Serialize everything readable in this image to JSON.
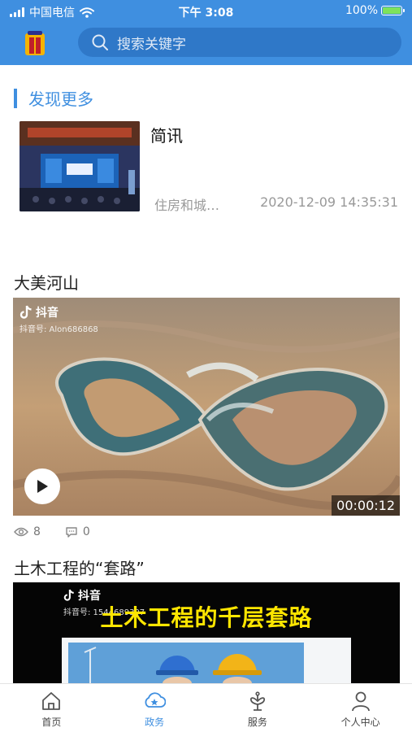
{
  "status_bar": {
    "carrier": "中国电信",
    "time": "下午 3:08",
    "battery": "100%"
  },
  "search": {
    "placeholder": "搜索关键字"
  },
  "discover": {
    "section_title": "发现更多",
    "news": {
      "title": "简讯",
      "source": "住房和城…",
      "date": "2020-12-09 14:35:31"
    }
  },
  "videos": [
    {
      "title": "大美河山",
      "platform": "抖音",
      "account": "抖音号: Alon686868",
      "duration": "00:00:12",
      "views": "8",
      "comments": "0"
    },
    {
      "title": "土木工程的“套路”",
      "platform": "抖音",
      "account": "抖音号: 1544689397",
      "overlay_text": "土木工程的千层套路"
    }
  ],
  "tabbar": {
    "tabs": [
      {
        "label": "首页",
        "icon": "home-icon"
      },
      {
        "label": "政务",
        "icon": "government-icon"
      },
      {
        "label": "服务",
        "icon": "service-icon"
      },
      {
        "label": "个人中心",
        "icon": "user-icon"
      }
    ],
    "active_tab": "政务"
  },
  "colors": {
    "brand": "#3f8fe0",
    "search_bg": "#2f78c8"
  }
}
